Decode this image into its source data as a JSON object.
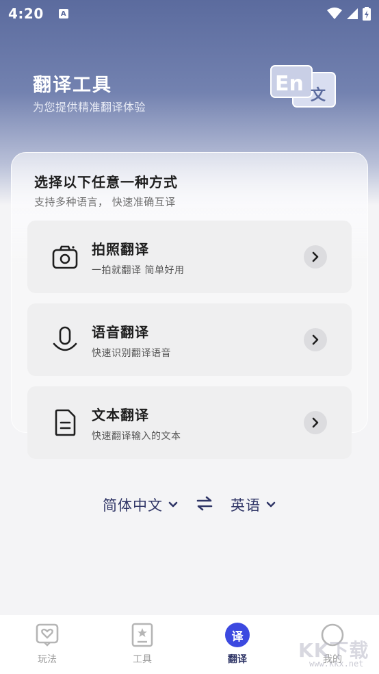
{
  "status": {
    "time": "4:20"
  },
  "header": {
    "title": "翻译工具",
    "subtitle": "为您提供精准翻译体验",
    "logo_text": "En",
    "logo_char": "文"
  },
  "panel": {
    "title": "选择以下任意一种方式",
    "subtitle": "支持多种语言， 快速准确互译"
  },
  "options": [
    {
      "icon": "camera-icon",
      "title": "拍照翻译",
      "subtitle": "一拍就翻译 简单好用"
    },
    {
      "icon": "microphone-icon",
      "title": "语音翻译",
      "subtitle": "快速识别翻译语音"
    },
    {
      "icon": "document-icon",
      "title": "文本翻译",
      "subtitle": "快速翻译输入的文本"
    }
  ],
  "language": {
    "source": "简体中文",
    "target": "英语"
  },
  "tabs": [
    {
      "label": "玩法",
      "icon": "heart-card-icon"
    },
    {
      "label": "工具",
      "icon": "star-bookmark-icon"
    },
    {
      "label": "翻译",
      "badge": "译",
      "active": true
    },
    {
      "label": "我的",
      "icon": "profile-icon"
    }
  ],
  "watermark": {
    "text": "KK下载",
    "url": "www.kkx.net"
  },
  "colors": {
    "header_bg": "#5b6b9e",
    "accent": "#3c49e0",
    "text_dark": "#2f3566"
  }
}
